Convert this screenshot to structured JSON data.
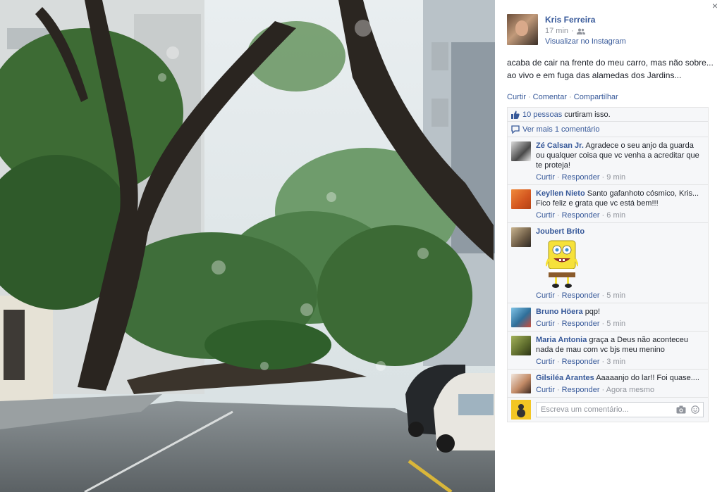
{
  "post": {
    "author": "Kris Ferreira",
    "time": "17 min",
    "privacy_icon": "friends-icon",
    "via_link": "Visualizar no Instagram",
    "text_line1": "acaba de cair na frente do meu carro, mas não sobre...",
    "text_line2": "ao vivo e em fuga das alamedas dos Jardins...",
    "actions": {
      "like": "Curtir",
      "comment": "Comentar",
      "share": "Compartilhar",
      "sep": " · "
    }
  },
  "likes": {
    "count_link": "10 pessoas",
    "suffix": " curtiram isso."
  },
  "more_comments": "Ver mais 1 comentário",
  "comments": [
    {
      "name": "Zé Calsan Jr.",
      "text": "Agradece o seu anjo da guarda ou qualquer coisa que vc venha a acreditar que te proteja!",
      "like": "Curtir",
      "reply": "Responder",
      "time": "9 min"
    },
    {
      "name": "Keyllen Nieto",
      "text": "Santo gafanhoto cósmico, Kris... Fico feliz e grata que vc está bem!!!",
      "like": "Curtir",
      "reply": "Responder",
      "time": "6 min"
    },
    {
      "name": "Joubert Brito",
      "text": "",
      "like": "Curtir",
      "reply": "Responder",
      "time": "5 min"
    },
    {
      "name": "Bruno Höera",
      "text": "pqp!",
      "like": "Curtir",
      "reply": "Responder",
      "time": "5 min"
    },
    {
      "name": "Maria Antonia",
      "text": "graça a Deus não aconteceu nada de mau com vc bjs meu menino",
      "like": "Curtir",
      "reply": "Responder",
      "time": "3 min"
    },
    {
      "name": "Gilsiléa Arantes",
      "text": "Aaaaanjo do lar!! Foi quase....",
      "like": "Curtir",
      "reply": "Responder",
      "time": "Agora mesmo"
    }
  ],
  "composer": {
    "placeholder": "Escreva um comentário..."
  },
  "ui": {
    "close": "×",
    "sep": " · "
  },
  "colors": {
    "link": "#365899",
    "meta": "#90949c",
    "panel_bg": "#f6f7f9"
  }
}
